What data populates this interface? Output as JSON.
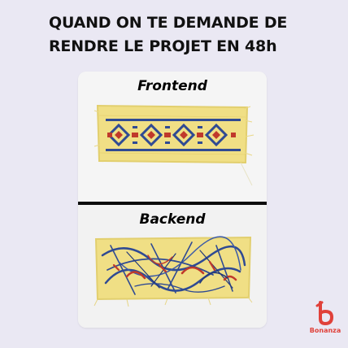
{
  "meme": {
    "title_line1": "QUAND ON TE DEMANDE DE",
    "title_line2": "RENDRE LE PROJET EN 48h",
    "top_panel_label": "Frontend",
    "bottom_panel_label": "Backend"
  },
  "brand": {
    "name": "Bonanza",
    "color": "#e0413a"
  }
}
